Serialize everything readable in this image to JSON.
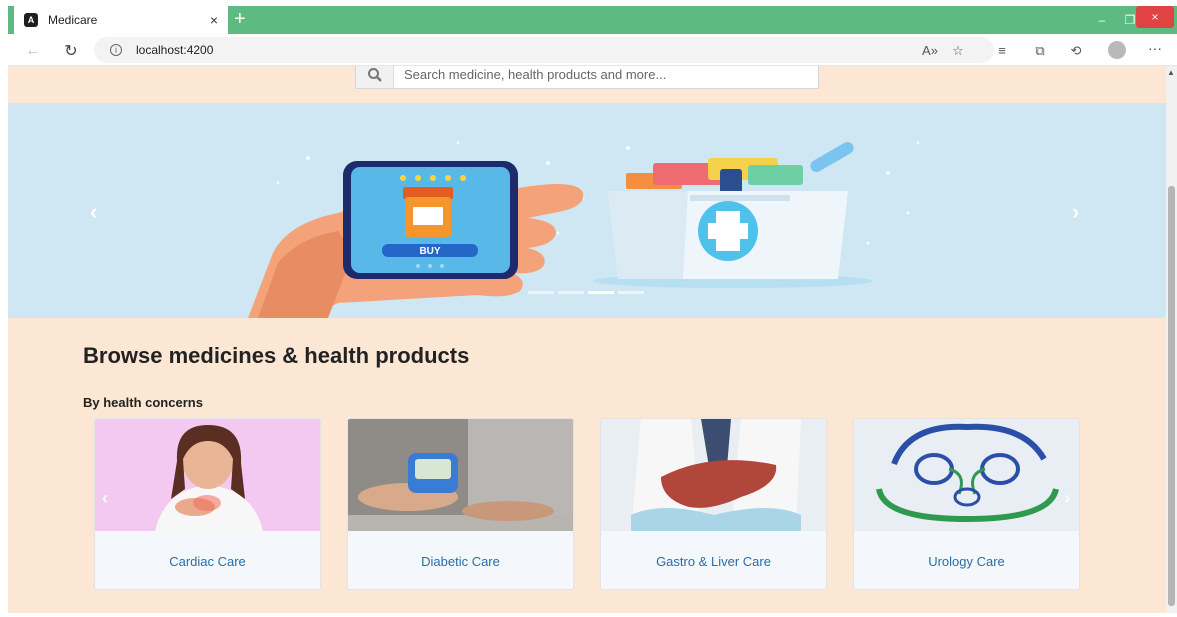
{
  "browser": {
    "tab_title": "Medicare",
    "tab_close": "×",
    "new_tab": "+",
    "url": "localhost:4200",
    "win_minimize": "–",
    "win_maximize": "❐",
    "win_close": "×",
    "more": "···"
  },
  "search": {
    "placeholder": "Search medicine, health products and more..."
  },
  "carousel": {
    "buy_label": "BUY",
    "slides_count": 4,
    "active_slide": 3
  },
  "section": {
    "title": "Browse medicines & health products",
    "subtitle": "By health concerns"
  },
  "categories": [
    {
      "label": "Cardiac Care"
    },
    {
      "label": "Diabetic Care"
    },
    {
      "label": "Gastro & Liver Care"
    },
    {
      "label": "Urology Care"
    }
  ],
  "colors": {
    "tabstrip": "#5dba80",
    "page_bg": "#fbe7d3",
    "banner_bg": "#cfe6f3",
    "link": "#2a6ea8"
  }
}
